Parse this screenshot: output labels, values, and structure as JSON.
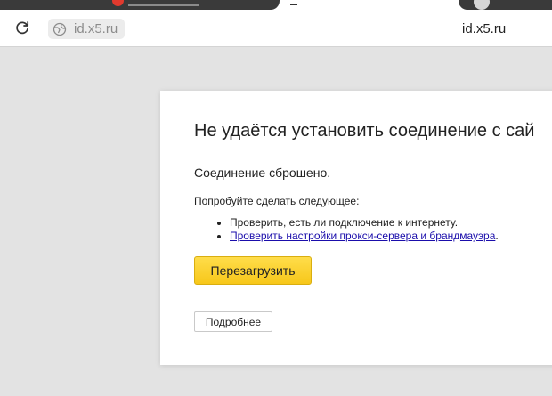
{
  "browser": {
    "address": "id.x5.ru",
    "page_title": "id.x5.ru",
    "icons": {
      "reload": "reload-icon",
      "site": "globe-icon"
    }
  },
  "error_page": {
    "title": "Не удаётся установить соединение с сай",
    "subtitle": "Соединение сброшено.",
    "try_label": "Попробуйте сделать следующее:",
    "suggestions": [
      "Проверить, есть ли подключение к интернету.",
      "Проверить настройки прокси-сервера и брандмауэра"
    ],
    "suggestion_suffix": ".",
    "reload_button": "Перезагрузить",
    "details_button": "Подробнее",
    "colors": {
      "reload_button": "#fcd53c",
      "link": "#1a0dab",
      "background": "#e3e3e3"
    }
  }
}
